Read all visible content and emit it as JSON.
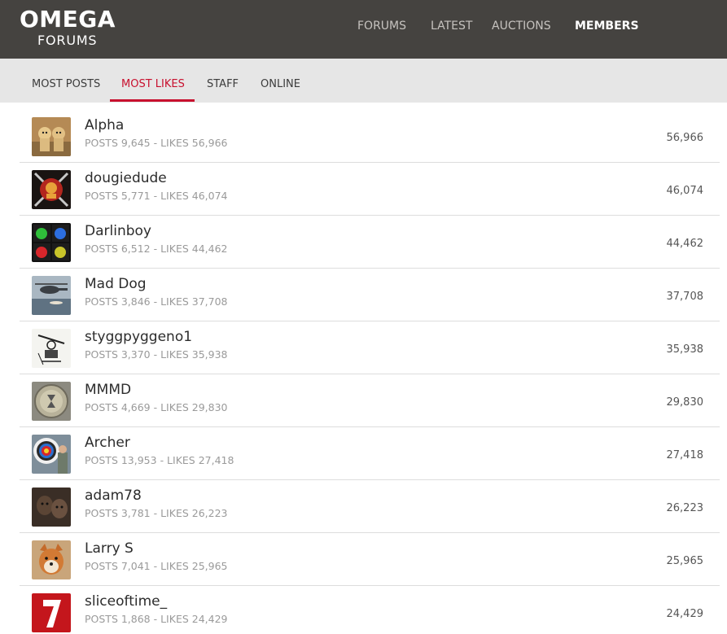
{
  "header": {
    "logo_line1": "OMEGA",
    "logo_line2": "FORUMS",
    "nav": [
      {
        "label": "FORUMS",
        "active": false
      },
      {
        "label": "LATEST",
        "active": false
      },
      {
        "label": "AUCTIONS",
        "active": false
      },
      {
        "label": "MEMBERS",
        "active": true
      }
    ]
  },
  "tabs": [
    {
      "label": "MOST POSTS",
      "active": false
    },
    {
      "label": "MOST LIKES",
      "active": true
    },
    {
      "label": "STAFF",
      "active": false
    },
    {
      "label": "ONLINE",
      "active": false
    }
  ],
  "members": [
    {
      "name": "Alpha",
      "stats": "POSTS 9,645 - LIKES 56,966",
      "likes": "56,966",
      "avatar": "two-dogs-avatar"
    },
    {
      "name": "dougiedude",
      "stats": "POSTS 5,771 - LIKES 46,074",
      "likes": "46,074",
      "avatar": "emblem-avatar"
    },
    {
      "name": "Darlinboy",
      "stats": "POSTS 6,512 - LIKES 44,462",
      "likes": "44,462",
      "avatar": "four-color-grid-avatar"
    },
    {
      "name": "Mad Dog",
      "stats": "POSTS 3,846 - LIKES 37,708",
      "likes": "37,708",
      "avatar": "helicopter-avatar"
    },
    {
      "name": "styggpyggeno1",
      "stats": "POSTS 3,370 - LIKES 35,938",
      "likes": "35,938",
      "avatar": "sketch-avatar"
    },
    {
      "name": "MMMD",
      "stats": "POSTS 4,669 - LIKES 29,830",
      "likes": "29,830",
      "avatar": "watch-dial-avatar"
    },
    {
      "name": "Archer",
      "stats": "POSTS 13,953 - LIKES 27,418",
      "likes": "27,418",
      "avatar": "archery-target-avatar"
    },
    {
      "name": "adam78",
      "stats": "POSTS 3,781 - LIKES 26,223",
      "likes": "26,223",
      "avatar": "dark-dogs-avatar"
    },
    {
      "name": "Larry S",
      "stats": "POSTS 7,041 - LIKES 25,965",
      "likes": "25,965",
      "avatar": "shiba-avatar"
    },
    {
      "name": "sliceoftime_",
      "stats": "POSTS 1,868 - LIKES 24,429",
      "likes": "24,429",
      "avatar": "red-seven-avatar"
    }
  ],
  "colors": {
    "header_bg": "#454340",
    "subbar_bg": "#e6e6e6",
    "accent": "#c8102e"
  }
}
